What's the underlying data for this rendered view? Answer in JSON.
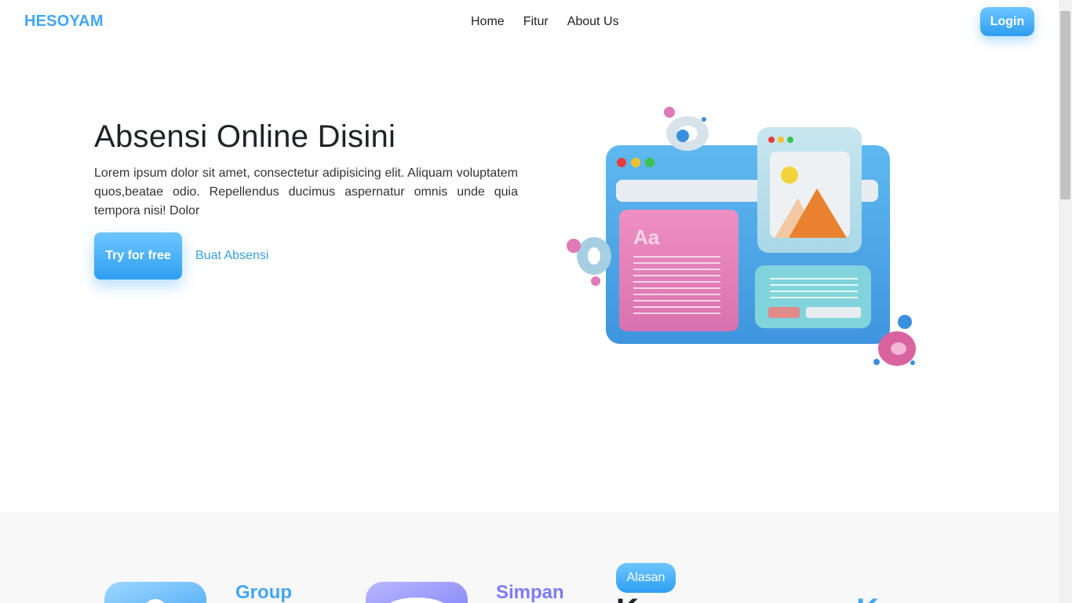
{
  "navbar": {
    "brand": "HESOYAM",
    "links": [
      "Home",
      "Fitur",
      "About Us"
    ],
    "login_label": "Login"
  },
  "hero": {
    "title": "Absensi Online Disini",
    "description": "Lorem ipsum dolor sit amet, consectetur adipisicing elit. Aliquam voluptatem quos,beatae odio. Repellendus ducimus aspernatur omnis unde quia tempora nisi! Dolor",
    "primary_button": "Try for free",
    "secondary_link": "Buat Absensi",
    "illustration_label": "Aa",
    "illustration_icon": "web-layout-3d-illustration"
  },
  "features": {
    "items": [
      {
        "title": "Group",
        "icon": "group-icon",
        "color": "#42a5f5"
      },
      {
        "title": "Simpan",
        "icon": "save-icon",
        "color": "#7d7cf5"
      }
    ],
    "badge": "Alasan",
    "heading_part1": "K",
    "heading_part2": "K"
  },
  "colors": {
    "accent": "#42a5f5",
    "accent_dark": "#2e9ef2",
    "purple": "#7d7cf5",
    "section_bg": "#f8f8f9"
  }
}
